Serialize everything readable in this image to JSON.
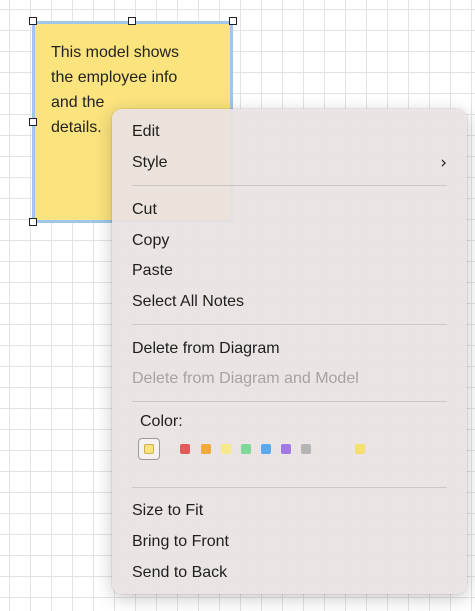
{
  "note": {
    "text": "This model shows\nthe employee info\nand the\ndetails."
  },
  "context_menu": {
    "edit": "Edit",
    "style": "Style",
    "style_chevron": "›",
    "cut": "Cut",
    "copy": "Copy",
    "paste": "Paste",
    "select_all_notes": "Select All Notes",
    "delete_from_diagram": "Delete from Diagram",
    "delete_from_diagram_and_model": "Delete from Diagram and Model",
    "color_label": "Color:",
    "size_to_fit": "Size to Fit",
    "bring_to_front": "Bring to Front",
    "send_to_back": "Send to Back"
  },
  "colors": {
    "selected": "#fbe37e",
    "swatches": [
      "#e25c5c",
      "#f0aa3c",
      "#f7e98a",
      "#7fd89a",
      "#5aa8ee",
      "#a27ae6",
      "#b4b4b4",
      "#f4e06e"
    ]
  }
}
